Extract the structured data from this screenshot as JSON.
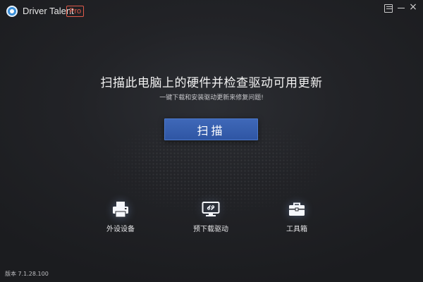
{
  "window": {
    "title": "Driver Talent",
    "badge": "Pro",
    "controls": [
      "menu-icon",
      "minimize-icon",
      "close-icon"
    ],
    "close_glyph": "×"
  },
  "main": {
    "headline": "扫描此电脑上的硬件并检查驱动可用更新",
    "subline": "一键下载和安装驱动更新来修复问题!",
    "scan_button": "扫描"
  },
  "tools": [
    {
      "label": "外设设备",
      "icon": "printer-icon"
    },
    {
      "label": "预下载驱动",
      "icon": "monitor-download-icon"
    },
    {
      "label": "工具箱",
      "icon": "toolbox-icon"
    }
  ],
  "footer": {
    "version": "版本 7.1.28.100"
  },
  "colors": {
    "accent": "#3a62b2",
    "badge": "#e05a4a",
    "background": "#1f2023",
    "text": "#e8e8ea"
  }
}
